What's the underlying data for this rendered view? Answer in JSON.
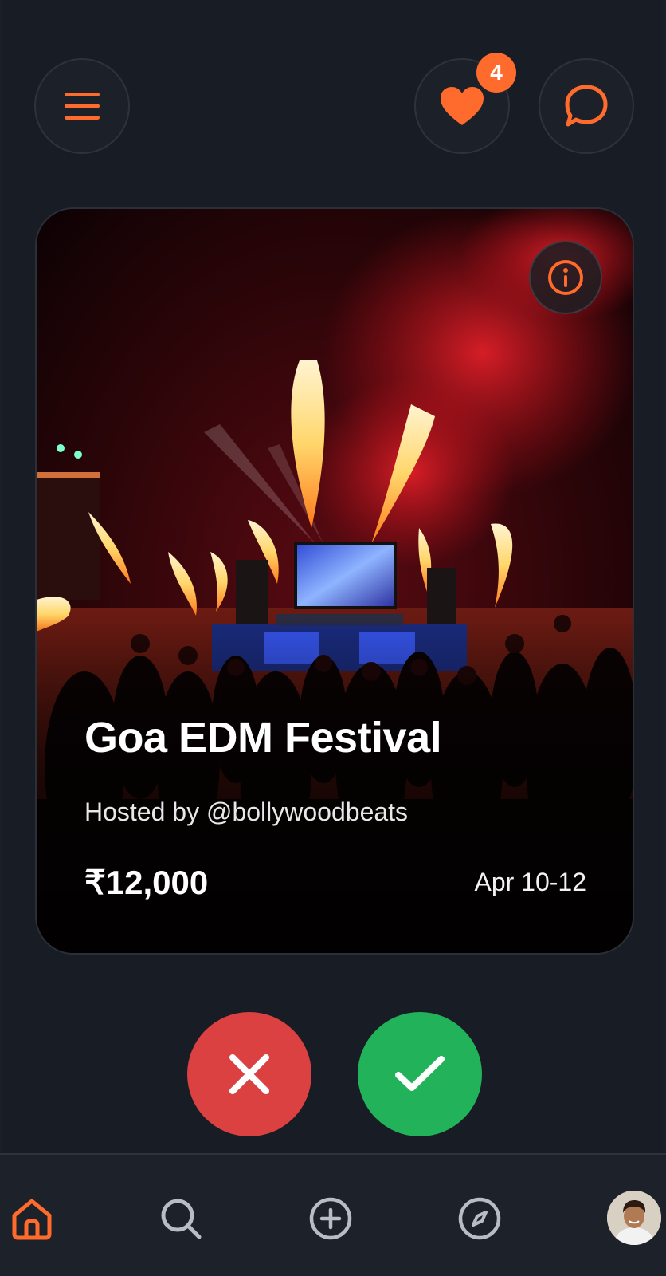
{
  "header": {
    "menu_icon": "hamburger-menu-icon",
    "favorites_icon": "heart-icon",
    "favorites_count": "4",
    "chat_icon": "chat-bubble-icon"
  },
  "card": {
    "title": "Goa EDM Festival",
    "host": "Hosted by @bollywoodbeats",
    "price": "₹12,000",
    "date": "Apr 10-12",
    "info_icon": "info-icon"
  },
  "actions": {
    "reject_icon": "close-icon",
    "accept_icon": "check-icon"
  },
  "bottom_nav": {
    "items": [
      {
        "icon": "home-icon",
        "active": true
      },
      {
        "icon": "search-icon",
        "active": false
      },
      {
        "icon": "add-circle-icon",
        "active": false
      },
      {
        "icon": "compass-icon",
        "active": false
      },
      {
        "icon": "avatar",
        "active": false
      }
    ]
  },
  "colors": {
    "accent": "#ff6b2c",
    "background": "#181d25",
    "reject": "#db4141",
    "accept": "#22b35a",
    "nav_inactive": "#b9bcc2"
  }
}
